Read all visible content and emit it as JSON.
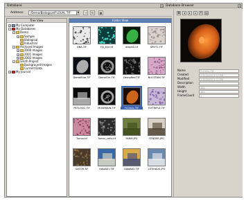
{
  "window": {
    "title_left": "Database",
    "title_right": "Database Browser"
  },
  "address": {
    "label": "Address:",
    "value": "/Demo/Biological/FLOUAL.TIF"
  },
  "toolbar_icons": [
    "go-icon",
    "refresh-icon",
    "view-grid-icon"
  ],
  "tree": {
    "header": "Tree View",
    "nodes": [
      {
        "label": "My Computer",
        "depth": 0,
        "exp": "+",
        "icon": "computer-icon"
      },
      {
        "label": "My Databases",
        "depth": 0,
        "exp": "-",
        "icon": "database-icon"
      },
      {
        "label": "Demo",
        "depth": 1,
        "exp": "-",
        "icon": "folder-icon"
      },
      {
        "label": "Sample",
        "depth": 2,
        "exp": "+",
        "icon": "folder-icon"
      },
      {
        "label": "Biological",
        "depth": 2,
        "exp": "",
        "icon": "folder-icon"
      },
      {
        "label": "Industrial",
        "depth": 2,
        "exp": "",
        "icon": "folder-icon"
      },
      {
        "label": "Archived Images",
        "depth": 1,
        "exp": "-",
        "icon": "folder-icon"
      },
      {
        "label": "2000 Images",
        "depth": 2,
        "exp": "+",
        "icon": "folder-icon"
      },
      {
        "label": "2001 Images",
        "depth": 2,
        "exp": "+",
        "icon": "folder-icon"
      },
      {
        "label": "2002 Images",
        "depth": 2,
        "exp": "+",
        "icon": "folder-icon"
      },
      {
        "label": "Smith Project",
        "depth": 1,
        "exp": "-",
        "icon": "folder-icon"
      },
      {
        "label": "Background Images",
        "depth": 2,
        "exp": "",
        "icon": "folder-icon"
      },
      {
        "label": "Current Data",
        "depth": 2,
        "exp": "",
        "icon": "folder-icon"
      },
      {
        "label": "My Journal",
        "depth": 0,
        "exp": "+",
        "icon": "journal-icon"
      }
    ]
  },
  "gallery": {
    "header": "Folder View",
    "items": [
      {
        "label": "DNA.TIF",
        "bg": "#e9e9e9",
        "fg": "#555555",
        "pattern": "dots"
      },
      {
        "label": "Fly_eye.tif",
        "bg": "#0b3d3b",
        "fg": "#3fd6c0",
        "pattern": "dots"
      },
      {
        "label": "aldpink.tif",
        "bg": "#0a1a0a",
        "fg": "#3cc24a",
        "pattern": "blob"
      },
      {
        "label": "SPOT1.TIF",
        "bg": "#d9d2cc",
        "fg": "#8d7f77",
        "pattern": "noise"
      },
      {
        "label": "DemoBlue.TIF",
        "bg": "#0d0d16",
        "fg": "#bfbfbf",
        "pattern": "blob"
      },
      {
        "label": "DemoGrn.TIF",
        "bg": "#101010",
        "fg": "#9a9a9a",
        "pattern": "ring"
      },
      {
        "label": "DemoRed.TIF",
        "bg": "#121212",
        "fg": "#7a7a7a",
        "pattern": "noise"
      },
      {
        "label": "NUCSTAIN.TIF",
        "bg": "#d7a8c8",
        "fg": "#8c4f7c",
        "pattern": "noise"
      },
      {
        "label": "PETLOGG.TIF",
        "bg": "#0a0a0a",
        "fg": "#d0d0d0",
        "pattern": "lines"
      },
      {
        "label": "MUSBRAIN.TIF",
        "bg": "#0c0c0c",
        "fg": "#a4a4a4",
        "pattern": "ring"
      },
      {
        "label": "FLOUAL.TIF",
        "bg": "#1a0b04",
        "fg": "#e0701e",
        "pattern": "blob"
      },
      {
        "label": "FLYTRIPLE.TIF",
        "bg": "#c9b8d8",
        "fg": "#6a5098",
        "pattern": "noise"
      },
      {
        "label": "Tumor.tif",
        "bg": "#cc8aa0",
        "fg": "#7a2f4a",
        "pattern": "noise"
      },
      {
        "label": "Tumor_cells.tif",
        "bg": "#2a2a2a",
        "fg": "#9a9a9a",
        "pattern": "noise"
      },
      {
        "label": "FARM.JPG",
        "bg": "#6e7e3a",
        "fg": "#3b4a1a",
        "pattern": "lines"
      },
      {
        "label": "FENDER.JPG",
        "bg": "#d7d0c4",
        "fg": "#4a3c2c",
        "pattern": "lines"
      },
      {
        "label": "GATOR.TIF",
        "bg": "#4a3a2a",
        "fg": "#9a7a4a",
        "pattern": "noise"
      },
      {
        "label": "HAWAII1.TIF",
        "bg": "#3a6aa6",
        "fg": "#e9e1c7",
        "pattern": "lines"
      },
      {
        "label": "HAWAII2.TIF",
        "bg": "#d9a94a",
        "fg": "#3a4a7a",
        "pattern": "lines"
      },
      {
        "label": "LITEHAUS.JPG",
        "bg": "#6a8ab0",
        "fg": "#f0f0f0",
        "pattern": "lines"
      }
    ],
    "selected_index": 10
  },
  "preview": {
    "props": [
      {
        "key": "Name",
        "value": "FLOUAL.TIF"
      },
      {
        "key": "Created",
        "value": "2/11/2003 2:37 PM"
      },
      {
        "key": "Modified",
        "value": "2/11/2003 2:37 PM"
      },
      {
        "key": "Description",
        "value": ""
      },
      {
        "key": "Width",
        "value": "480"
      },
      {
        "key": "Height",
        "value": "480"
      },
      {
        "key": "FrameCount",
        "value": "1"
      }
    ]
  }
}
